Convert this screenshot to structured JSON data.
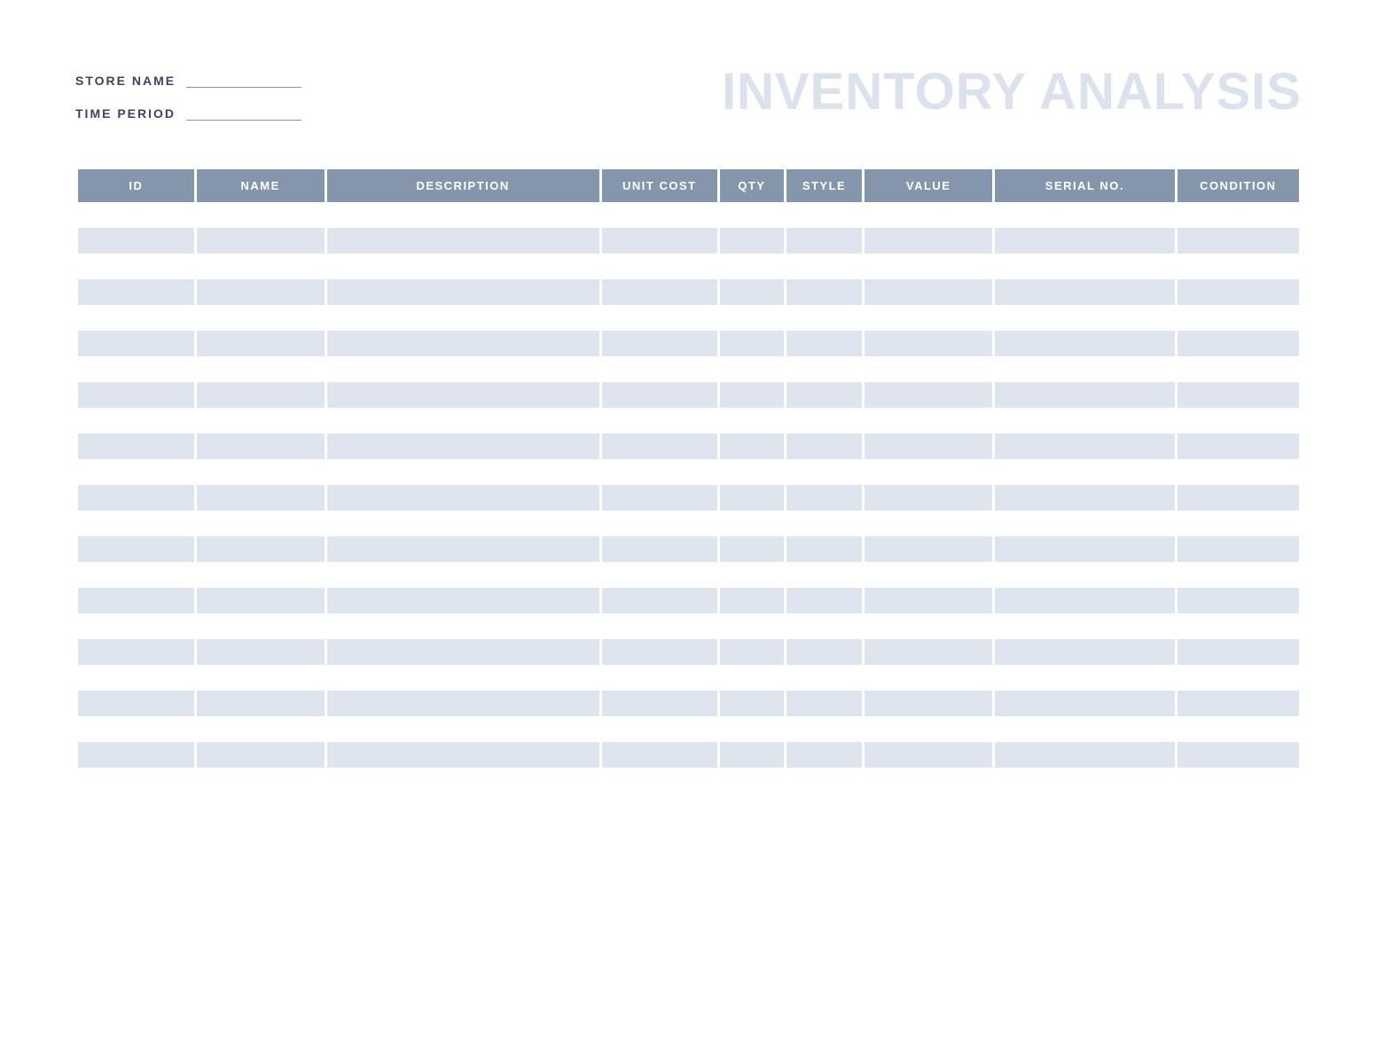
{
  "header": {
    "store_name_label": "STORE NAME",
    "time_period_label": "TIME PERIOD",
    "store_name_value": "",
    "time_period_value": "",
    "title": "INVENTORY ANALYSIS"
  },
  "table": {
    "columns": [
      {
        "label": "ID",
        "class": "col-id"
      },
      {
        "label": "NAME",
        "class": "col-name"
      },
      {
        "label": "DESCRIPTION",
        "class": "col-description"
      },
      {
        "label": "UNIT COST",
        "class": "col-unitcost"
      },
      {
        "label": "QTY",
        "class": "col-qty"
      },
      {
        "label": "STYLE",
        "class": "col-style"
      },
      {
        "label": "VALUE",
        "class": "col-value"
      },
      {
        "label": "SERIAL NO.",
        "class": "col-serial"
      },
      {
        "label": "CONDITION",
        "class": "col-condition"
      }
    ],
    "row_count": 22
  },
  "colors": {
    "header_bg": "#8495ac",
    "row_alt_bg": "#dfe5ef",
    "title_color": "#dce2ed",
    "label_color": "#3a4560"
  }
}
